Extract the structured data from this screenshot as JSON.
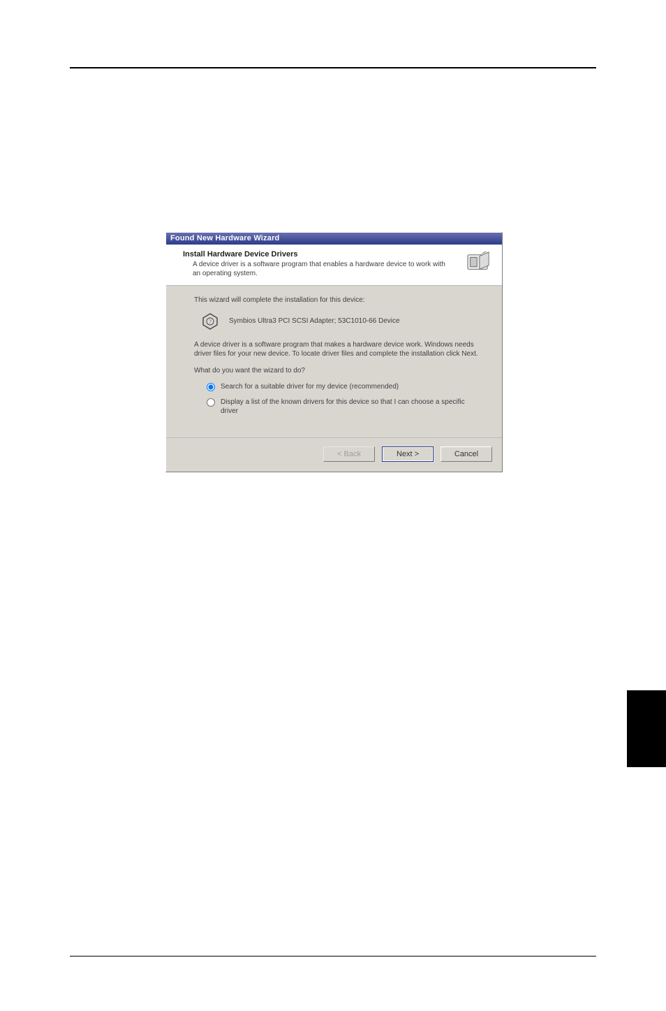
{
  "dialog": {
    "title": "Found New Hardware Wizard",
    "header_title": "Install Hardware Device Drivers",
    "header_sub": "A device driver is a software program that enables a hardware device to work with an operating system.",
    "completes_text": "This wizard will complete the installation for this device:",
    "device_name": "Symbios Ultra3 PCI SCSI Adapter; 53C1010-66 Device",
    "explain_text": "A device driver is a software program that makes a hardware device work. Windows needs driver files for your new device. To locate driver files and complete the installation click Next.",
    "prompt": "What do you want the wizard to do?",
    "radios": [
      "Search for a suitable driver for my device (recommended)",
      "Display a list of the known drivers for this device so that I can choose a specific driver"
    ],
    "buttons": {
      "back": "< Back",
      "next": "Next >",
      "cancel": "Cancel"
    }
  }
}
